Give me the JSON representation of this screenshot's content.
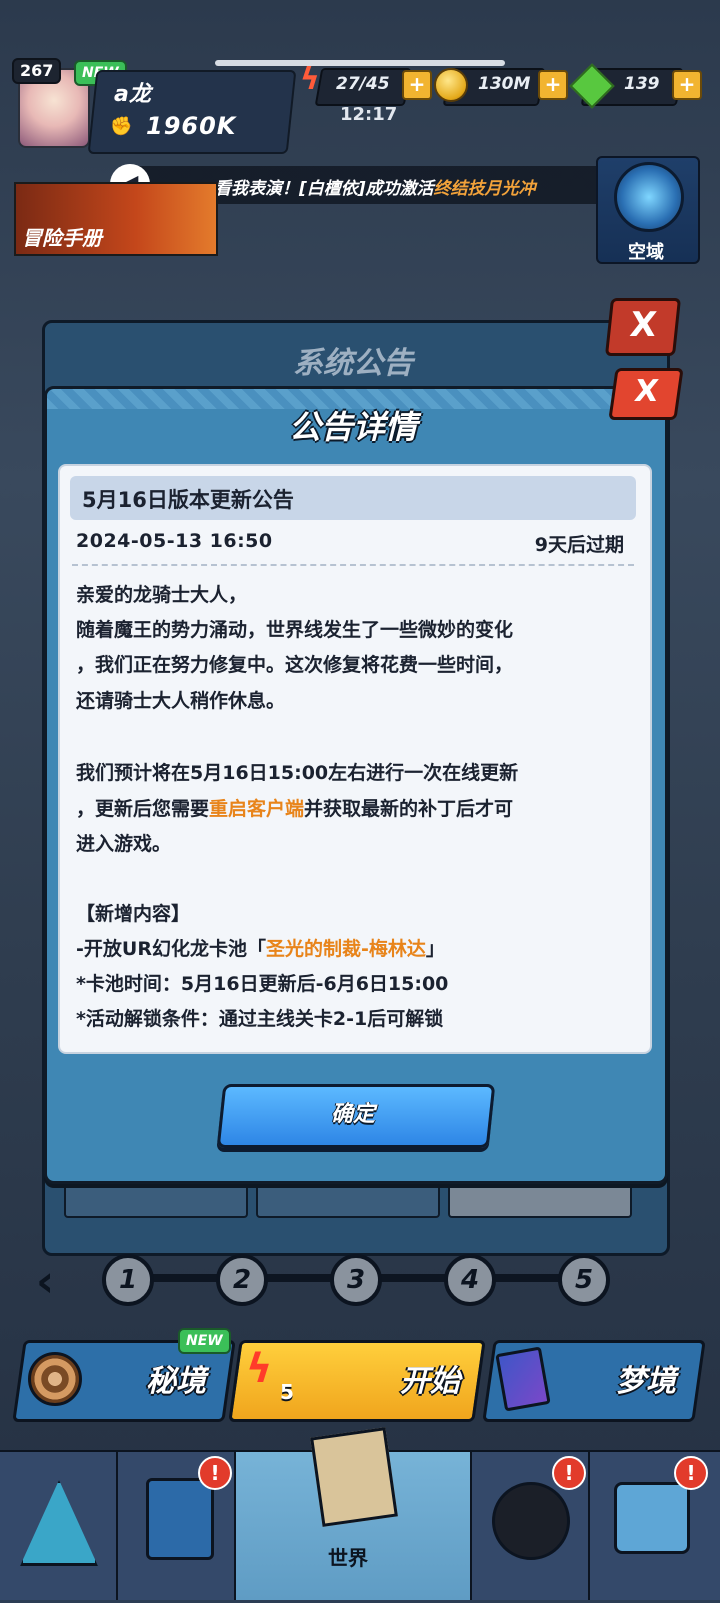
{
  "player": {
    "level": "267",
    "new_badge": "NEW",
    "name": "a龙",
    "power": "1960K"
  },
  "resources": {
    "energy": "27/45",
    "timer": "12:17",
    "coins": "130M",
    "gems": "139",
    "plus": "+"
  },
  "ticker": {
    "prefix": "看我表演！[白檀依]成功激活",
    "highlight": "终结技月光冲"
  },
  "side": {
    "adventure_manual": "冒险手册",
    "airspace": "空域"
  },
  "system_panel": {
    "title": "系统公告",
    "close": "X"
  },
  "modal": {
    "title": "公告详情",
    "close": "X",
    "notice_title": "5月16日版本更新公告",
    "date": "2024-05-13 16:50",
    "expire": "9天后过期",
    "body": {
      "line1": "亲爱的龙骑士大人，",
      "line2": "随着魔王的势力涌动，世界线发生了一些微妙的变化",
      "line3": "，我们正在努力修复中。这次修复将花费一些时间，",
      "line4": "还请骑士大人稍作休息。",
      "line5": "我们预计将在5月16日15:00左右进行一次在线更新",
      "line6_pre": "，更新后您需要",
      "line6_hl": "重启客户端",
      "line6_post": "并获取最新的补丁后才可",
      "line7": "进入游戏。",
      "line8": "【新增内容】",
      "line9_pre": "-开放UR幻化龙卡池「",
      "line9_hl": "圣光的制裁-梅林达",
      "line9_post": "」",
      "line10": "*卡池时间：5月16日更新后-6月6日15:00",
      "line11": "*活动解锁条件：通过主线关卡2-1后可解锁"
    },
    "confirm": "确定"
  },
  "stages": [
    "1",
    "2",
    "3",
    "4",
    "5"
  ],
  "back_arrow": "‹",
  "modes": {
    "secret": "秘境",
    "secret_new": "NEW",
    "start": "开始",
    "start_cost": "5",
    "dream": "梦境"
  },
  "bottom_nav": {
    "world": "世界",
    "alert": "!"
  },
  "colors": {
    "modal_bg": "#3f87b4",
    "highlight": "#e8841a",
    "confirm_btn": "#2e86e6",
    "start_btn": "#f0a51d"
  }
}
